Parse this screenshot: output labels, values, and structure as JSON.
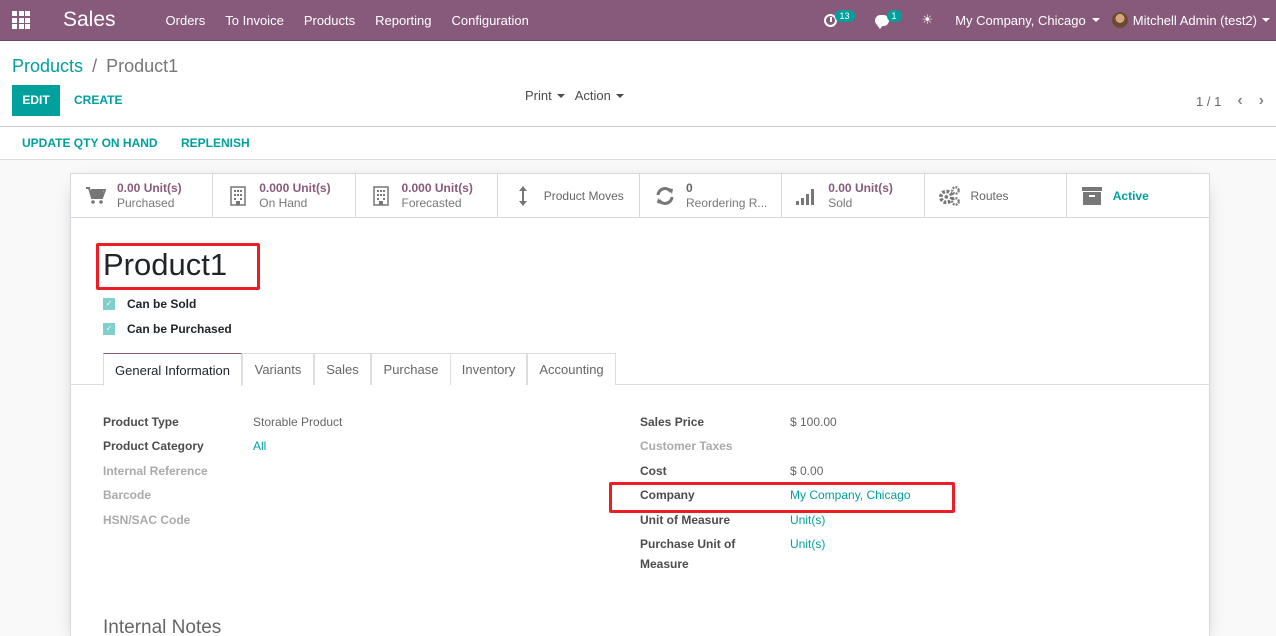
{
  "navbar": {
    "app_name": "Sales",
    "menu": [
      "Orders",
      "To Invoice",
      "Products",
      "Reporting",
      "Configuration"
    ],
    "activity_count": "13",
    "message_count": "1",
    "company": "My Company, Chicago",
    "user": "Mitchell Admin (test2)",
    "bg_color": "#875a7b"
  },
  "control_panel": {
    "breadcrumb": {
      "parent": "Products",
      "separator": "/",
      "current": "Product1"
    },
    "edit_label": "EDIT",
    "create_label": "CREATE",
    "print_label": "Print",
    "action_label": "Action",
    "pager": "1 / 1"
  },
  "statusbar": {
    "update_qty_label": "UPDATE QTY ON HAND",
    "replenish_label": "REPLENISH"
  },
  "smart_buttons": [
    {
      "icon": "cart-icon",
      "value": "0.00 Unit(s)",
      "label": "Purchased"
    },
    {
      "icon": "building-icon",
      "value": "0.000 Unit(s)",
      "label": "On Hand"
    },
    {
      "icon": "building-icon",
      "value": "0.000 Unit(s)",
      "label": "Forecasted"
    },
    {
      "icon": "arrows-vertical-icon",
      "label": "Product Moves"
    },
    {
      "icon": "refresh-icon",
      "value": "0",
      "label": "Reordering R..."
    },
    {
      "icon": "bar-chart-icon",
      "value": "0.00 Unit(s)",
      "label": "Sold"
    },
    {
      "icon": "gears-icon",
      "label": "Routes"
    },
    {
      "icon": "archive-icon",
      "label": "Active"
    }
  ],
  "product": {
    "name": "Product1",
    "can_be_sold_label": "Can be Sold",
    "can_be_sold": true,
    "can_be_purchased_label": "Can be Purchased",
    "can_be_purchased": true
  },
  "tabs": [
    "General Information",
    "Variants",
    "Sales",
    "Purchase",
    "Inventory",
    "Accounting"
  ],
  "active_tab": "General Information",
  "left_fields": [
    {
      "label": "Product Type",
      "value": "Storable Product"
    },
    {
      "label": "Product Category",
      "value": "All"
    },
    {
      "label": "Internal Reference",
      "value": ""
    },
    {
      "label": "Barcode",
      "value": ""
    },
    {
      "label": "HSN/SAC Code",
      "value": ""
    }
  ],
  "right_fields": [
    {
      "label": "Sales Price",
      "value": "$ 100.00"
    },
    {
      "label": "Customer Taxes",
      "value": ""
    },
    {
      "label": "Cost",
      "value": "$ 0.00"
    },
    {
      "label": "Company",
      "value": "My Company, Chicago"
    },
    {
      "label": "Unit of Measure",
      "value": "Unit(s)"
    },
    {
      "label": "Purchase Unit of Measure",
      "value": "Unit(s)"
    }
  ],
  "notes_title": "Internal Notes",
  "colors": {
    "accent": "#00a09d",
    "primary": "#875a7b",
    "highlight": "#ee1c24"
  }
}
